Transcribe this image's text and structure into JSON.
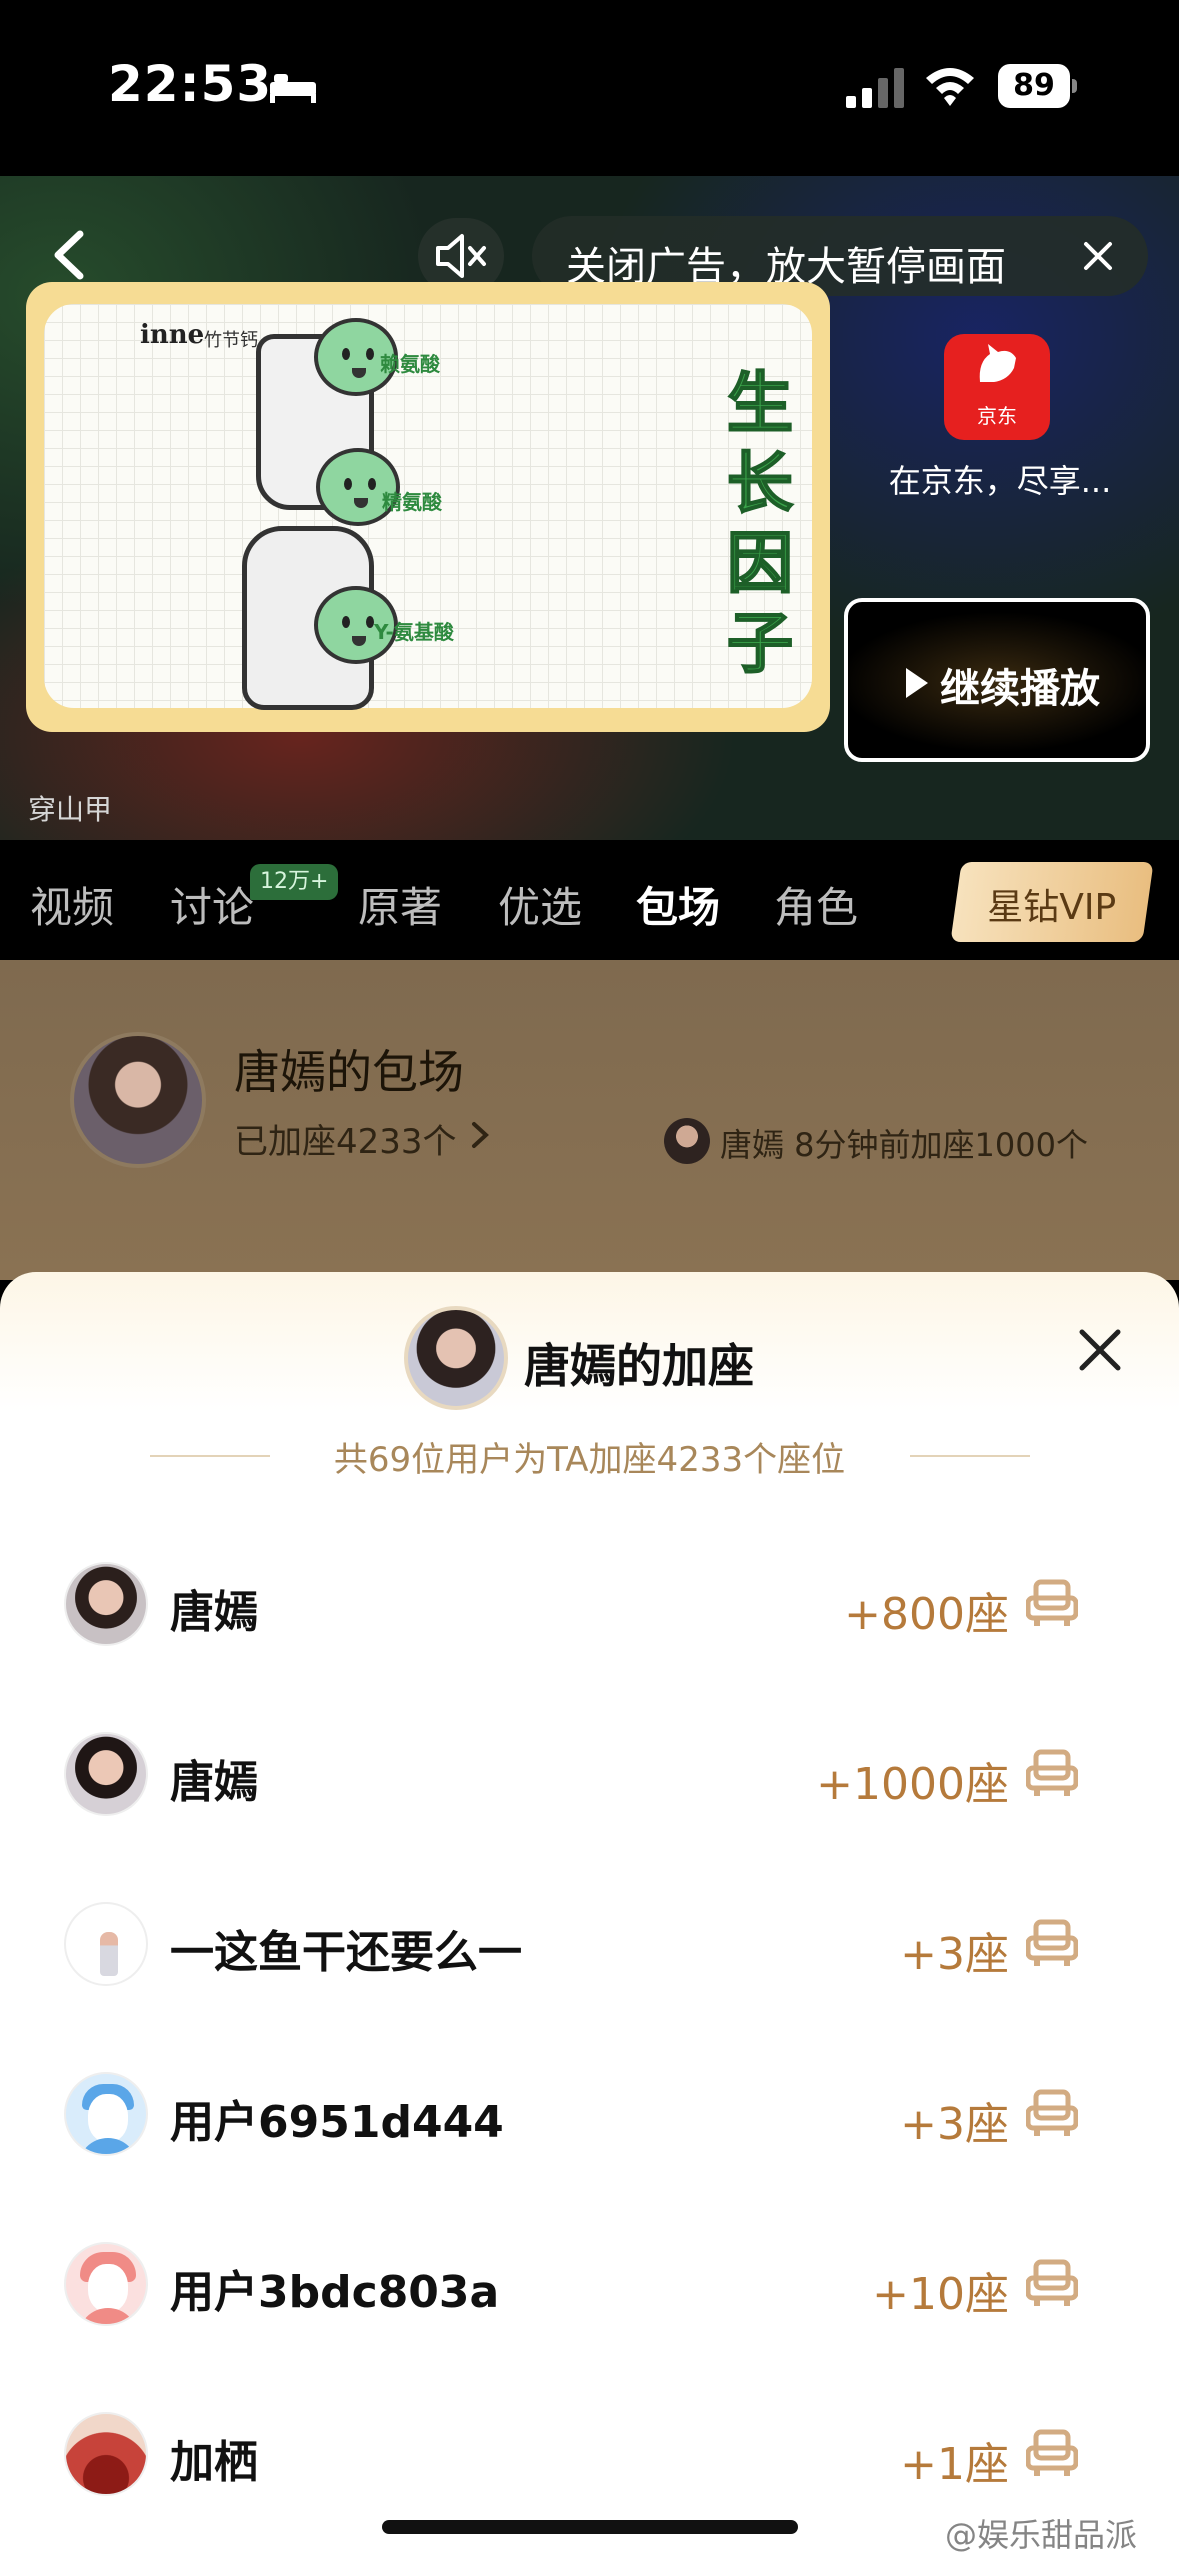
{
  "status_bar": {
    "time": "22:53",
    "battery": "89"
  },
  "video": {
    "close_ad_text": "关闭广告，放大暂停画面",
    "ad": {
      "brand": "inne",
      "brand_sub": "竹节钙",
      "balls": [
        "赖氨酸",
        "精氨酸",
        "Y-氨基酸"
      ],
      "big_title": "生长因子"
    },
    "sponsor_logo_text": "京东",
    "sponsor_slogan": "在京东，尽享...",
    "continue_label": "继续播放",
    "channel_label": "穿山甲"
  },
  "tabs": [
    {
      "label": "视频",
      "active": false
    },
    {
      "label": "讨论",
      "active": false,
      "badge": "12万+"
    },
    {
      "label": "原著",
      "active": false
    },
    {
      "label": "优选",
      "active": false
    },
    {
      "label": "包场",
      "active": true
    },
    {
      "label": "角色",
      "active": false
    }
  ],
  "vip_label": "星钻VIP",
  "package": {
    "title": "唐嫣的包场",
    "subtitle": "已加座4233个",
    "recent_activity": "唐嫣 8分钟前加座1000个"
  },
  "sheet": {
    "title": "唐嫣的加座",
    "summary": "共69位用户为TA加座4233个座位",
    "rows": [
      {
        "name": "唐嫣",
        "seats": "+800座"
      },
      {
        "name": "唐嫣",
        "seats": "+1000座"
      },
      {
        "name": "一这鱼干还要么一",
        "seats": "+3座"
      },
      {
        "name": "用户6951d444",
        "seats": "+3座"
      },
      {
        "name": "用户3bdc803a",
        "seats": "+10座"
      },
      {
        "name": "加栖",
        "seats": "+1座"
      }
    ]
  },
  "watermark": "@娱乐甜品派",
  "colors": {
    "accent_gold": "#b57a3b",
    "tab_active": "#ffffff",
    "vip_gradient_start": "#f7e2bd",
    "vip_gradient_end": "#e9be80"
  }
}
